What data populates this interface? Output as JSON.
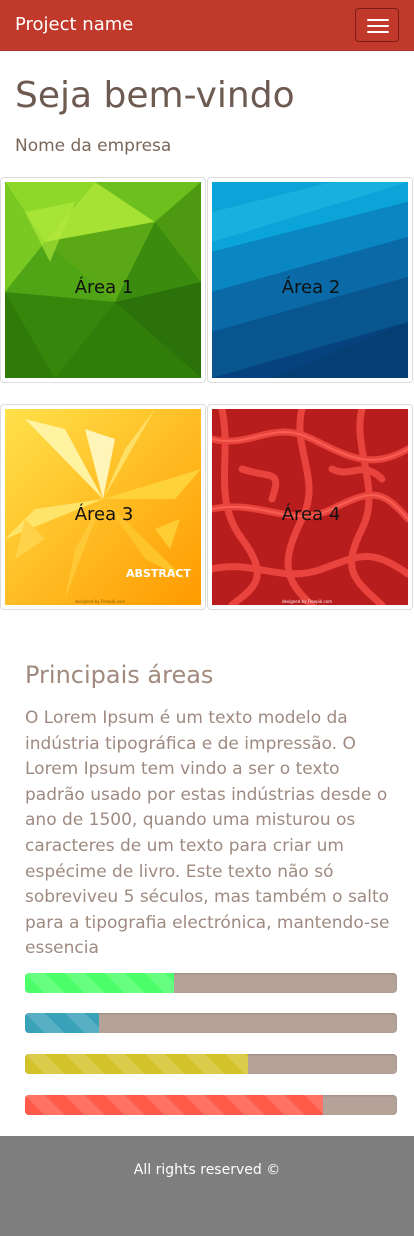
{
  "navbar": {
    "brand": "Project name",
    "toggle_icon": "hamburger-menu-icon",
    "color": "#c0392b"
  },
  "hero": {
    "title": "Seja bem-vindo",
    "subtitle": "Nome da empresa"
  },
  "tiles": [
    {
      "label": "Área 1",
      "theme": "green-polygons"
    },
    {
      "label": "Área 2",
      "theme": "blue-layers"
    },
    {
      "label": "Área 3",
      "theme": "yellow-abstract",
      "overlay_text": "ABSTRACT",
      "credit": "designed by Freepik.com"
    },
    {
      "label": "Área 4",
      "theme": "red-web",
      "credit": "designed by Freepik.com"
    }
  ],
  "section": {
    "title": "Principais áreas",
    "text": "O Lorem Ipsum é um texto modelo da indústria tipográfica e de impressão. O Lorem Ipsum tem vindo a ser o texto padrão usado por estas indústrias desde o ano de 1500, quando uma misturou os caracteres de um texto para criar um espécime de livro. Este texto não só sobreviveu 5 séculos, mas também o salto para a tipografia electrónica, mantendo-se essencia"
  },
  "progress_bars": [
    {
      "value": 40,
      "color": "#4cff6a"
    },
    {
      "value": 20,
      "color": "#39a1b8"
    },
    {
      "value": 60,
      "color": "#d4c22a"
    },
    {
      "value": 80,
      "color": "#ff5a4a"
    }
  ],
  "footer": {
    "text": "All rights reserved ©"
  }
}
